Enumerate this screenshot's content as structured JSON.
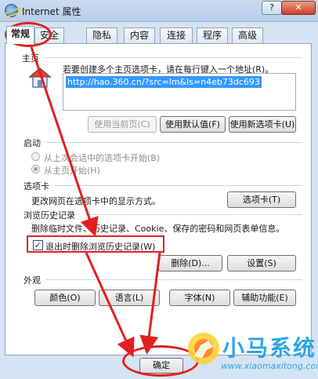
{
  "window": {
    "title": "Internet 属性",
    "help_label": "?",
    "close_label": "✕"
  },
  "tabs": [
    {
      "label": "常规",
      "active": true
    },
    {
      "label": "安全"
    },
    {
      "label": "隐私"
    },
    {
      "label": "内容"
    },
    {
      "label": "连接"
    },
    {
      "label": "程序"
    },
    {
      "label": "高级"
    }
  ],
  "homepage": {
    "section_label": "主页",
    "description": "若要创建多个主页选项卡，请在每行键入一个地址(R)。",
    "url": "http://hao.360.cn/?src=lm&ls=n4eb73dc693",
    "use_current_label": "使用当前页(C)",
    "use_default_label": "使用默认值(F)",
    "use_new_tab_label": "使用新选项卡(U)",
    "icon": "house-icon"
  },
  "startup": {
    "section_label": "启动",
    "option_last_session": "从上次会话中的选项卡开始(B)",
    "option_homepage": "从主页开始(H)",
    "selected": "option_homepage"
  },
  "tabs_section": {
    "section_label": "选项卡",
    "description": "更改网页在选项卡中的显示方式。",
    "button_label": "选项卡(T)"
  },
  "history": {
    "section_label": "浏览历史记录",
    "description": "删除临时文件、历史记录、Cookie、保存的密码和网页表单信息。",
    "checkbox_label": "退出时删除浏览历史记录(W)",
    "checkbox_checked": true,
    "delete_label": "删除(D)...",
    "settings_label": "设置(S)"
  },
  "appearance": {
    "section_label": "外观",
    "colors_label": "颜色(O)",
    "languages_label": "语言(L)",
    "fonts_label": "字体(N)",
    "accessibility_label": "辅助功能(E)"
  },
  "footer": {
    "ok_label": "确定"
  },
  "watermark": {
    "name": "小马系统",
    "url": "www.xiaomaxitong.com"
  },
  "colors": {
    "highlight": "#e02020",
    "accent": "#2ba6e8",
    "selection": "#3399ff"
  }
}
